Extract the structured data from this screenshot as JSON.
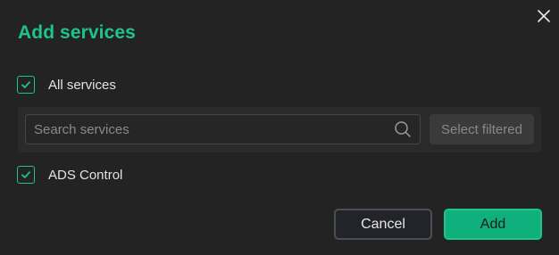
{
  "dialog": {
    "title": "Add services",
    "close_icon": "close-icon"
  },
  "all_services": {
    "label": "All services",
    "checked": true
  },
  "search": {
    "placeholder": "Search services",
    "value": "",
    "icon": "search-icon",
    "select_filtered_label": "Select filtered"
  },
  "services": [
    {
      "label": "ADS Control",
      "checked": true
    }
  ],
  "actions": {
    "cancel_label": "Cancel",
    "add_label": "Add"
  },
  "colors": {
    "accent": "#1fc38c",
    "background": "#232323"
  }
}
